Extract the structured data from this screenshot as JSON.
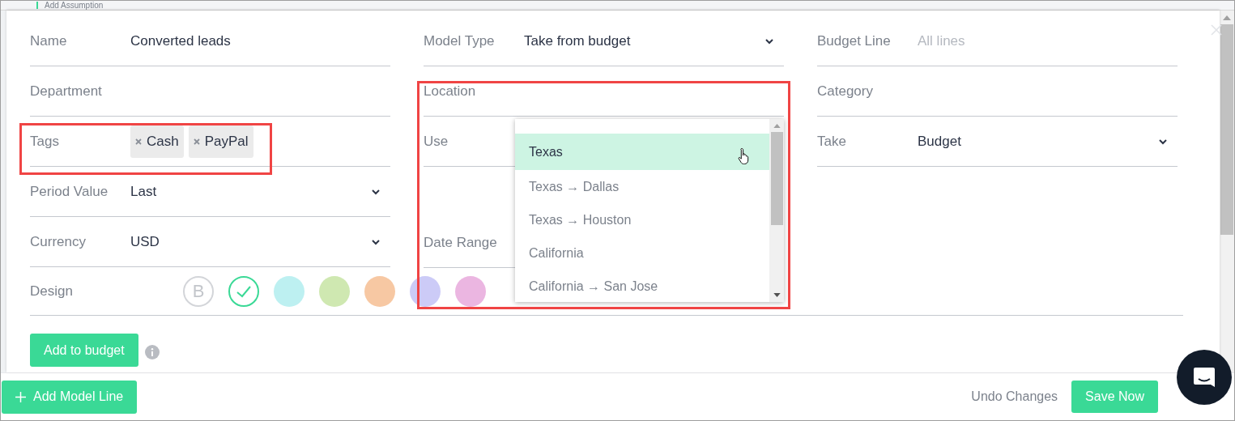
{
  "background": {
    "link": "Add Assumption"
  },
  "columns": [
    [
      {
        "kind": "text",
        "label": "Name",
        "value": "Converted leads"
      },
      {
        "kind": "text",
        "label": "Department"
      },
      {
        "kind": "tags",
        "label": "Tags",
        "tags": [
          "Cash",
          "PayPal"
        ]
      },
      {
        "kind": "select",
        "label": "Period Value",
        "value": "Last"
      },
      {
        "kind": "select",
        "label": "Currency",
        "value": "USD"
      }
    ],
    [
      {
        "kind": "select",
        "label": "Model Type",
        "value": "Take from budget"
      },
      {
        "kind": "text",
        "label": "Location"
      },
      {
        "kind": "text",
        "label": "Use"
      },
      {
        "kind": "text",
        "label": "Date Range"
      }
    ],
    [
      {
        "kind": "text",
        "label": "Budget Line",
        "placeholder": "All lines"
      },
      {
        "kind": "text",
        "label": "Category"
      },
      {
        "kind": "select",
        "label": "Take",
        "value": "Budget"
      }
    ]
  ],
  "design": {
    "label": "Design",
    "swatches": [
      {
        "kind": "letter",
        "text": "B",
        "selected": false
      },
      {
        "kind": "color",
        "color": "#3ad996",
        "selected": true
      },
      {
        "kind": "color",
        "color": "#bdf0f1",
        "selected": false
      },
      {
        "kind": "color",
        "color": "#cfe8b1",
        "selected": false
      },
      {
        "kind": "color",
        "color": "#f7c8a3",
        "selected": false
      },
      {
        "kind": "color",
        "color": "#cccbf7",
        "selected": false
      },
      {
        "kind": "color",
        "color": "#ebb6e1",
        "selected": false
      }
    ]
  },
  "add_button": "Add to budget",
  "location_dropdown": [
    {
      "label": "Texas",
      "selected": true
    },
    {
      "label": "Texas → Dallas",
      "selected": false
    },
    {
      "label": "Texas → Houston",
      "selected": false
    },
    {
      "label": "California",
      "selected": false
    },
    {
      "label": "California → San Jose",
      "selected": false
    }
  ],
  "footer": {
    "add_line": "Add Model Line",
    "undo": "Undo Changes",
    "save": "Save Now"
  }
}
